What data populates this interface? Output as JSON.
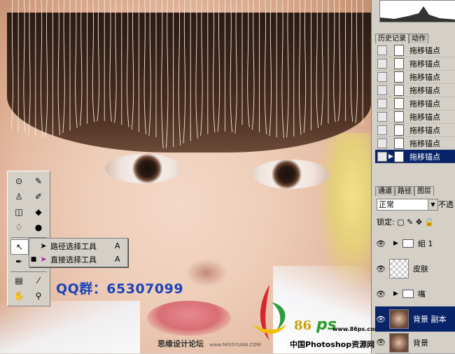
{
  "panels": {
    "history_tabs": [
      "历史记录",
      "动作"
    ],
    "history_items": [
      "拖移锚点",
      "拖移锚点",
      "拖移锚点",
      "拖移锚点",
      "拖移锚点",
      "拖移锚点",
      "拖移锚点",
      "拖移锚点",
      "拖移锚点"
    ],
    "layers_tabs": [
      "通道",
      "路径",
      "图层"
    ],
    "blend_mode": "正常",
    "opacity_label": "不透",
    "lock_label": "锁定:",
    "layers": [
      {
        "name": "組 1",
        "type": "group"
      },
      {
        "name": "皮肤",
        "type": "layer"
      },
      {
        "name": "嘴",
        "type": "group"
      },
      {
        "name": "背景 副本",
        "type": "image",
        "selected": true
      },
      {
        "name": "背景",
        "type": "image"
      }
    ]
  },
  "flyout": {
    "items": [
      {
        "label": "路径选择工具",
        "key": "A",
        "active": false
      },
      {
        "label": "直接选择工具",
        "key": "A",
        "active": true
      }
    ]
  },
  "overlay": {
    "qq": "QQ群：65307099",
    "site1": "思缘设计论坛",
    "site1_url": "www.MISSYUAN.COM",
    "logo_num": "86",
    "logo_ps": "ps",
    "url86": "www.86ps.com",
    "cn_ps": "中国Photoshop资源网"
  },
  "colors": {
    "selection": "#0a246a",
    "qq_text": "#1c44b8",
    "panel_bg": "#d4d0c8"
  }
}
